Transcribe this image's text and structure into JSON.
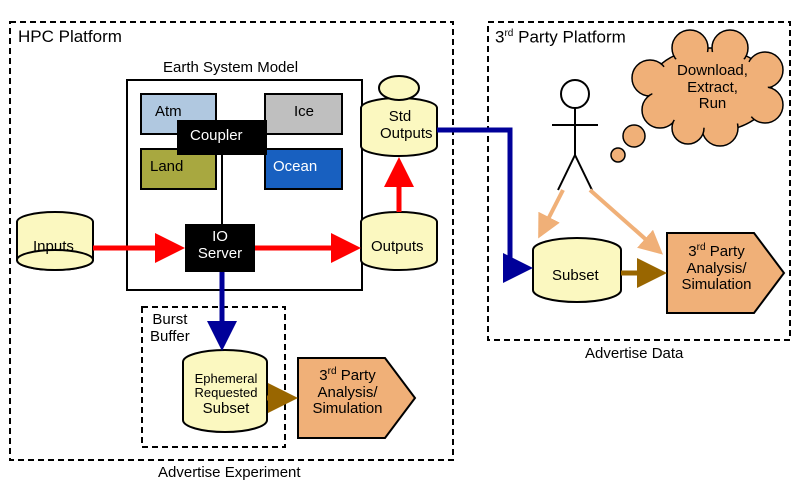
{
  "hpc": {
    "title": "HPC Platform",
    "esm_title": "Earth System Model",
    "atm": "Atm",
    "ice": "Ice",
    "land": "Land",
    "ocean": "Ocean",
    "coupler": "Coupler",
    "io_server_l1": "IO",
    "io_server_l2": "Server",
    "inputs": "Inputs",
    "outputs": "Outputs",
    "std_outputs_l1": "Std",
    "std_outputs_l2": "Outputs",
    "burst_title_l1": "Burst",
    "burst_title_l2": "Buffer",
    "ephemeral": "Ephemeral",
    "requested": "Requested",
    "subset": "Subset",
    "advertise_exp": "Advertise Experiment"
  },
  "party": {
    "title_prefix": "3",
    "title_suffix": "Party Platform",
    "rd": "rd",
    "cloud_l1": "Download,",
    "cloud_l2": "Extract,",
    "cloud_l3": "Run",
    "subset": "Subset",
    "analysis_l1_pre": "3",
    "analysis_l1_post": " Party",
    "analysis_l2": "Analysis/",
    "analysis_l3": "Simulation",
    "advertise_data": "Advertise Data"
  },
  "analysis": {
    "l1_pre": "3",
    "l1_post": " Party",
    "rd": "rd",
    "l2": "Analysis/",
    "l3": "Simulation"
  }
}
